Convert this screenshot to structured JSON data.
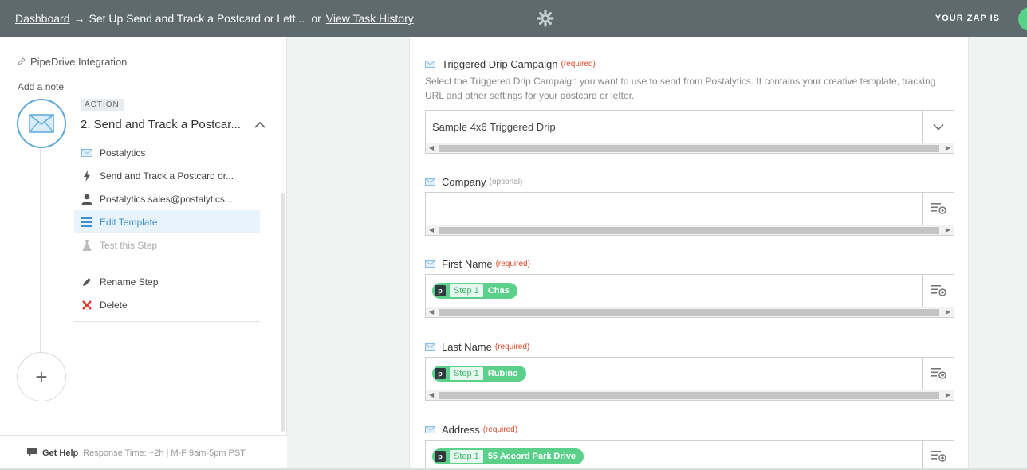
{
  "header": {
    "dashboard_link": "Dashboard",
    "arrow": "→",
    "zap_title": "Set Up Send and Track a Postcard or Lett...",
    "or_text": "or",
    "task_history_link": "View Task History",
    "zap_status_label": "YOUR ZAP IS"
  },
  "sidebar": {
    "zap_name": "PipeDrive Integration",
    "add_note": "Add a note",
    "step_badge": "ACTION",
    "step_title": "2. Send and Track a Postcar...",
    "menu": [
      {
        "label": "Postalytics",
        "icon": "envelope-icon"
      },
      {
        "label": "Send and Track a Postcard or...",
        "icon": "lightning-icon"
      },
      {
        "label": "Postalytics sales@postalytics....",
        "icon": "user-icon"
      },
      {
        "label": "Edit Template",
        "icon": "list-icon",
        "active": true
      },
      {
        "label": "Test this Step",
        "icon": "flask-icon",
        "disabled": true
      },
      {
        "label": "Rename Step",
        "icon": "pencil-icon"
      },
      {
        "label": "Delete",
        "icon": "close-icon"
      }
    ],
    "add_step_symbol": "+",
    "help": {
      "label": "Get Help",
      "response": "Response Time: ~2h | M-F 9am-5pm PST"
    }
  },
  "form": {
    "fields": [
      {
        "label": "Triggered Drip Campaign",
        "tag": "(required)",
        "description": "Select the Triggered Drip Campaign you want to use to send from Postalytics. It contains your creative template, tracking URL and other settings for your postcard or letter.",
        "value": "Sample 4x6 Triggered Drip"
      },
      {
        "label": "Company",
        "tag": "(optional)",
        "value": ""
      },
      {
        "label": "First Name",
        "tag": "(required)",
        "pill": {
          "app": "p",
          "step": "Step 1",
          "value": "Chas"
        }
      },
      {
        "label": "Last Name",
        "tag": "(required)",
        "pill": {
          "app": "p",
          "step": "Step 1",
          "value": "Rubino"
        }
      },
      {
        "label": "Address",
        "tag": "(required)",
        "pill": {
          "app": "p",
          "step": "Step 1",
          "value": "55 Accord Park Drive"
        }
      }
    ]
  },
  "colors": {
    "header_bg": "#5f6a6e",
    "accent_blue": "#3c8fd0",
    "pill_green": "#5ad08a",
    "required_red": "#d94a2b"
  }
}
